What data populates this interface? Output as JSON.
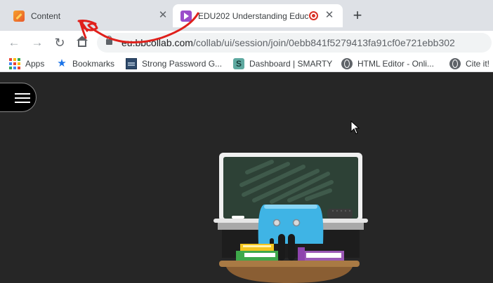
{
  "tabs": [
    {
      "title": "Content",
      "icon": "pencil-icon"
    },
    {
      "title": "EDU202 Understanding Educ",
      "icon": "collaborate-icon",
      "recording": true
    }
  ],
  "toolbar": {
    "url_host": "eu.bbcollab.com",
    "url_path": "/collab/ui/session/join/0ebb841f5279413fa91cf0e721ebb302"
  },
  "bookmarks": [
    {
      "label": "Apps"
    },
    {
      "label": "Bookmarks"
    },
    {
      "label": "Strong Password G..."
    },
    {
      "label": "Dashboard | SMARTY"
    },
    {
      "label": "HTML Editor - Onli..."
    },
    {
      "label": "Cite it!"
    }
  ],
  "colors": {
    "annotation": "#e0201b",
    "page_background": "#262626",
    "chalkboard": "#2d4136",
    "mascot": "#3fb4e5"
  }
}
